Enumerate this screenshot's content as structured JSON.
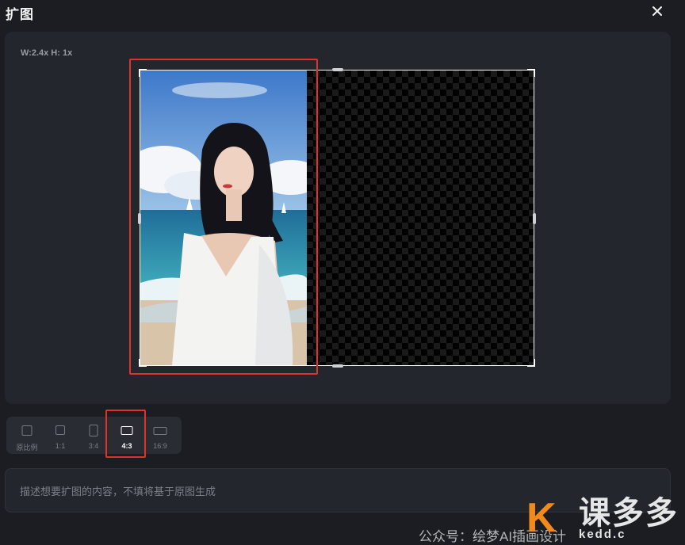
{
  "dialog": {
    "title": "扩图",
    "close_icon": "close-icon"
  },
  "canvas": {
    "scale_readout": "W:2.4x H: 1x",
    "image_description_icon": "portrait-photo",
    "expand_area": "transparent-checkerboard"
  },
  "ratios": [
    {
      "label": "原比例",
      "icon": "original-ratio-icon",
      "active": false
    },
    {
      "label": "1:1",
      "icon": "square-1-1-icon",
      "active": false
    },
    {
      "label": "3:4",
      "icon": "portrait-3-4-icon",
      "active": false
    },
    {
      "label": "4:3",
      "icon": "landscape-4-3-icon",
      "active": true
    },
    {
      "label": "16:9",
      "icon": "wide-16-9-icon",
      "active": false
    }
  ],
  "prompt": {
    "placeholder": "描述想要扩图的内容，不填将基于原图生成",
    "value": ""
  },
  "watermark": {
    "text": "公众号：绘梦AI插画设计",
    "brand": "课多多",
    "url": "kedd.c"
  },
  "colors": {
    "highlight": "#e0312a",
    "accent_orange": "#f28a1b",
    "background": "#1b1d23"
  }
}
